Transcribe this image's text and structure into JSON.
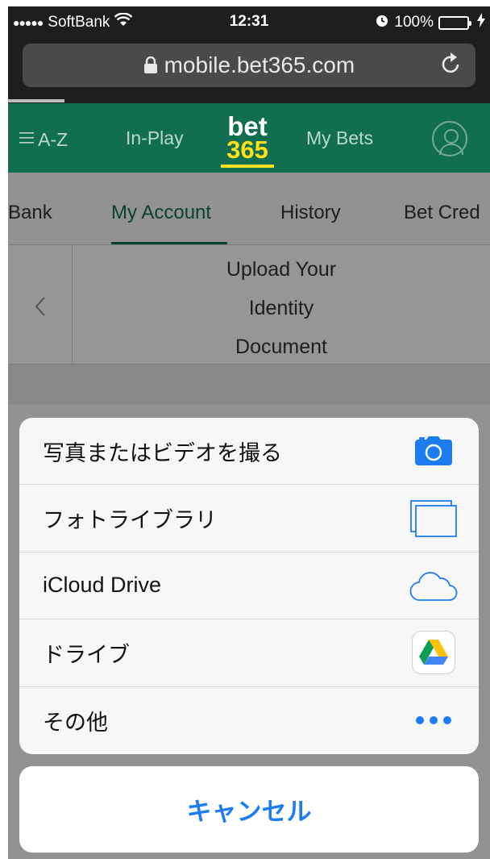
{
  "status_bar": {
    "signal": "●●●●●",
    "carrier": "SoftBank",
    "wifi_icon": "wifi-icon",
    "time": "12:31",
    "alarm_icon": "alarm-icon",
    "battery": "100%",
    "battery_color": "#4cd964",
    "charging_icon": "bolt-icon"
  },
  "browser": {
    "lock_icon": "lock-icon",
    "url": "mobile.bet365.com",
    "reload_icon": "reload-icon"
  },
  "nav": {
    "menu_icon": "menu-icon",
    "az": "A-Z",
    "in_play": "In-Play",
    "logo_top": "bet",
    "logo_bottom": "365",
    "my_bets": "My Bets",
    "account_icon": "user-icon",
    "background": "#126e51",
    "logo_yellow": "#ffdf1b"
  },
  "tabs": {
    "items": [
      "Bank",
      "My Account",
      "History",
      "Bet Cred"
    ],
    "active": "My Account",
    "accent": "#126e51"
  },
  "upload": {
    "back_icon": "chevron-left-icon",
    "title_lines": [
      "Upload Your",
      "Identity",
      "Document"
    ]
  },
  "action_sheet": {
    "items": [
      {
        "label": "写真またはビデオを撮る",
        "icon": "camera-icon"
      },
      {
        "label": "フォトライブラリ",
        "icon": "photo-library-icon"
      },
      {
        "label": "iCloud Drive",
        "icon": "icloud-icon"
      },
      {
        "label": "ドライブ",
        "icon": "google-drive-icon"
      },
      {
        "label": "その他",
        "icon": "more-icon"
      }
    ],
    "cancel_label": "キャンセル",
    "accent": "#1e7cf2"
  }
}
